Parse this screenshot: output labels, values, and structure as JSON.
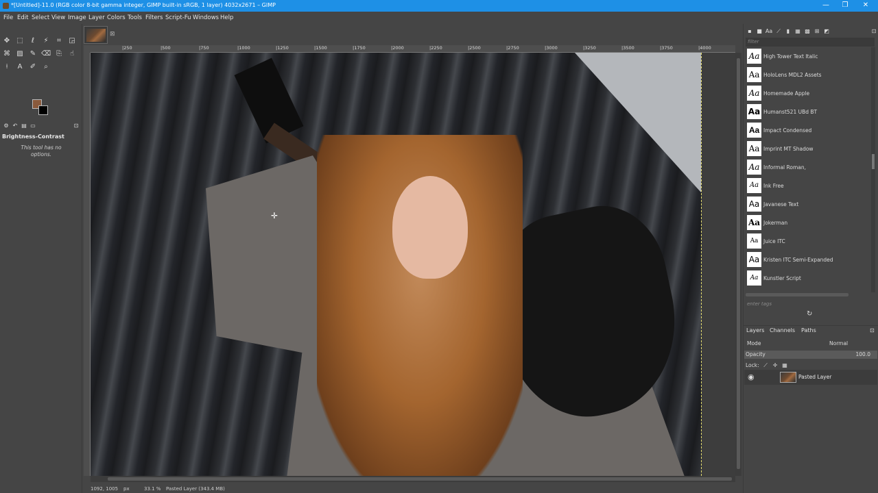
{
  "window": {
    "title": "*[Untitled]-11.0 (RGB color 8-bit gamma integer, GIMP built-in sRGB, 1 layer) 4032x2671 – GIMP",
    "controls": {
      "minimize": "—",
      "restore": "❐",
      "close": "✕"
    }
  },
  "menu": [
    "File",
    "Edit",
    "Select",
    "View",
    "Image",
    "Layer",
    "Colors",
    "Tools",
    "Filters",
    "Script-Fu",
    "Windows",
    "Help"
  ],
  "toolbox": {
    "tool_options_title": "Brightness-Contrast",
    "tool_options_text": "This tool has no options.",
    "foreground_color": "#8a5a3c",
    "background_color": "#000000"
  },
  "ruler": {
    "labels": [
      "|250",
      "|500",
      "|750",
      "|1000",
      "|1250",
      "|1500",
      "|1750",
      "|2000",
      "|2250",
      "|2500",
      "|2750",
      "|3000",
      "|3250",
      "|3500",
      "|3750",
      "|4000"
    ]
  },
  "statusbar": {
    "coords": "1092, 1005",
    "unit": "px",
    "zoom": "33.1 %",
    "layer_info": "Pasted Layer (343.4 MB)"
  },
  "fonts": {
    "filter_placeholder": "filter",
    "tag_placeholder": "enter tags",
    "items": [
      {
        "preview": "Aa",
        "name": "High Tower Text Italic"
      },
      {
        "preview": "Aa",
        "name": "HoloLens MDL2 Assets"
      },
      {
        "preview": "Aa",
        "name": "Homemade Apple"
      },
      {
        "preview": "Aa",
        "name": "Humanst521 UBd BT"
      },
      {
        "preview": "Aa",
        "name": "Impact Condensed"
      },
      {
        "preview": "Aa",
        "name": "Imprint MT Shadow"
      },
      {
        "preview": "Aa",
        "name": "Informal Roman,"
      },
      {
        "preview": "Aa",
        "name": "Ink Free"
      },
      {
        "preview": "Aa",
        "name": "Javanese Text"
      },
      {
        "preview": "Aa",
        "name": "Jokerman"
      },
      {
        "preview": "Aa",
        "name": "Juice ITC"
      },
      {
        "preview": "Aa",
        "name": "Kristen ITC Semi-Expanded"
      },
      {
        "preview": "Aa",
        "name": "Kunstler Script"
      }
    ]
  },
  "layers": {
    "tabs": [
      "Layers",
      "Channels",
      "Paths"
    ],
    "mode_label": "Mode",
    "mode_value": "Normal",
    "opacity_label": "Opacity",
    "opacity_value": "100.0",
    "lock_label": "Lock:",
    "items": [
      {
        "name": "Pasted Layer"
      }
    ]
  }
}
